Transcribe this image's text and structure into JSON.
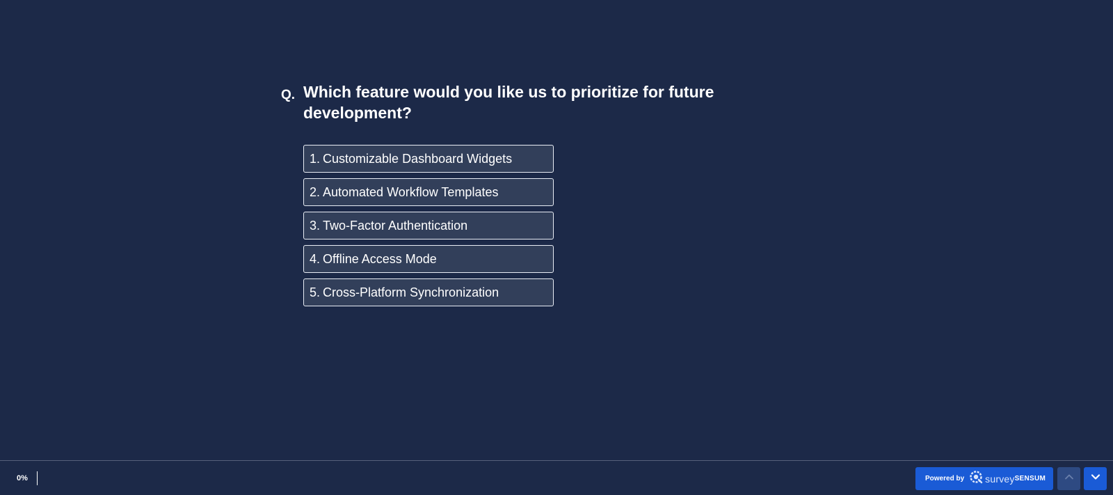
{
  "question": {
    "prefix": "Q.",
    "text": "Which feature would you like us to prioritize for future development?"
  },
  "options": [
    {
      "number": "1.",
      "label": "Customizable Dashboard Widgets"
    },
    {
      "number": "2.",
      "label": "Automated Workflow Templates"
    },
    {
      "number": "3.",
      "label": "Two-Factor Authentication"
    },
    {
      "number": "4.",
      "label": "Offline Access Mode"
    },
    {
      "number": "5.",
      "label": "Cross-Platform Synchronization"
    }
  ],
  "footer": {
    "progress_text": "0%",
    "progress_value": 0,
    "powered_by": "Powered by",
    "brand_survey": "survey",
    "brand_sensum": "SENSUM",
    "up_icon": "chevron-up-icon",
    "down_icon": "chevron-down-icon"
  },
  "colors": {
    "background": "#1c2948",
    "option_bg": "#323f5a",
    "option_border": "#e9edf5",
    "accent": "#1a5bd6",
    "nav_up_bg": "#2e4a82"
  }
}
